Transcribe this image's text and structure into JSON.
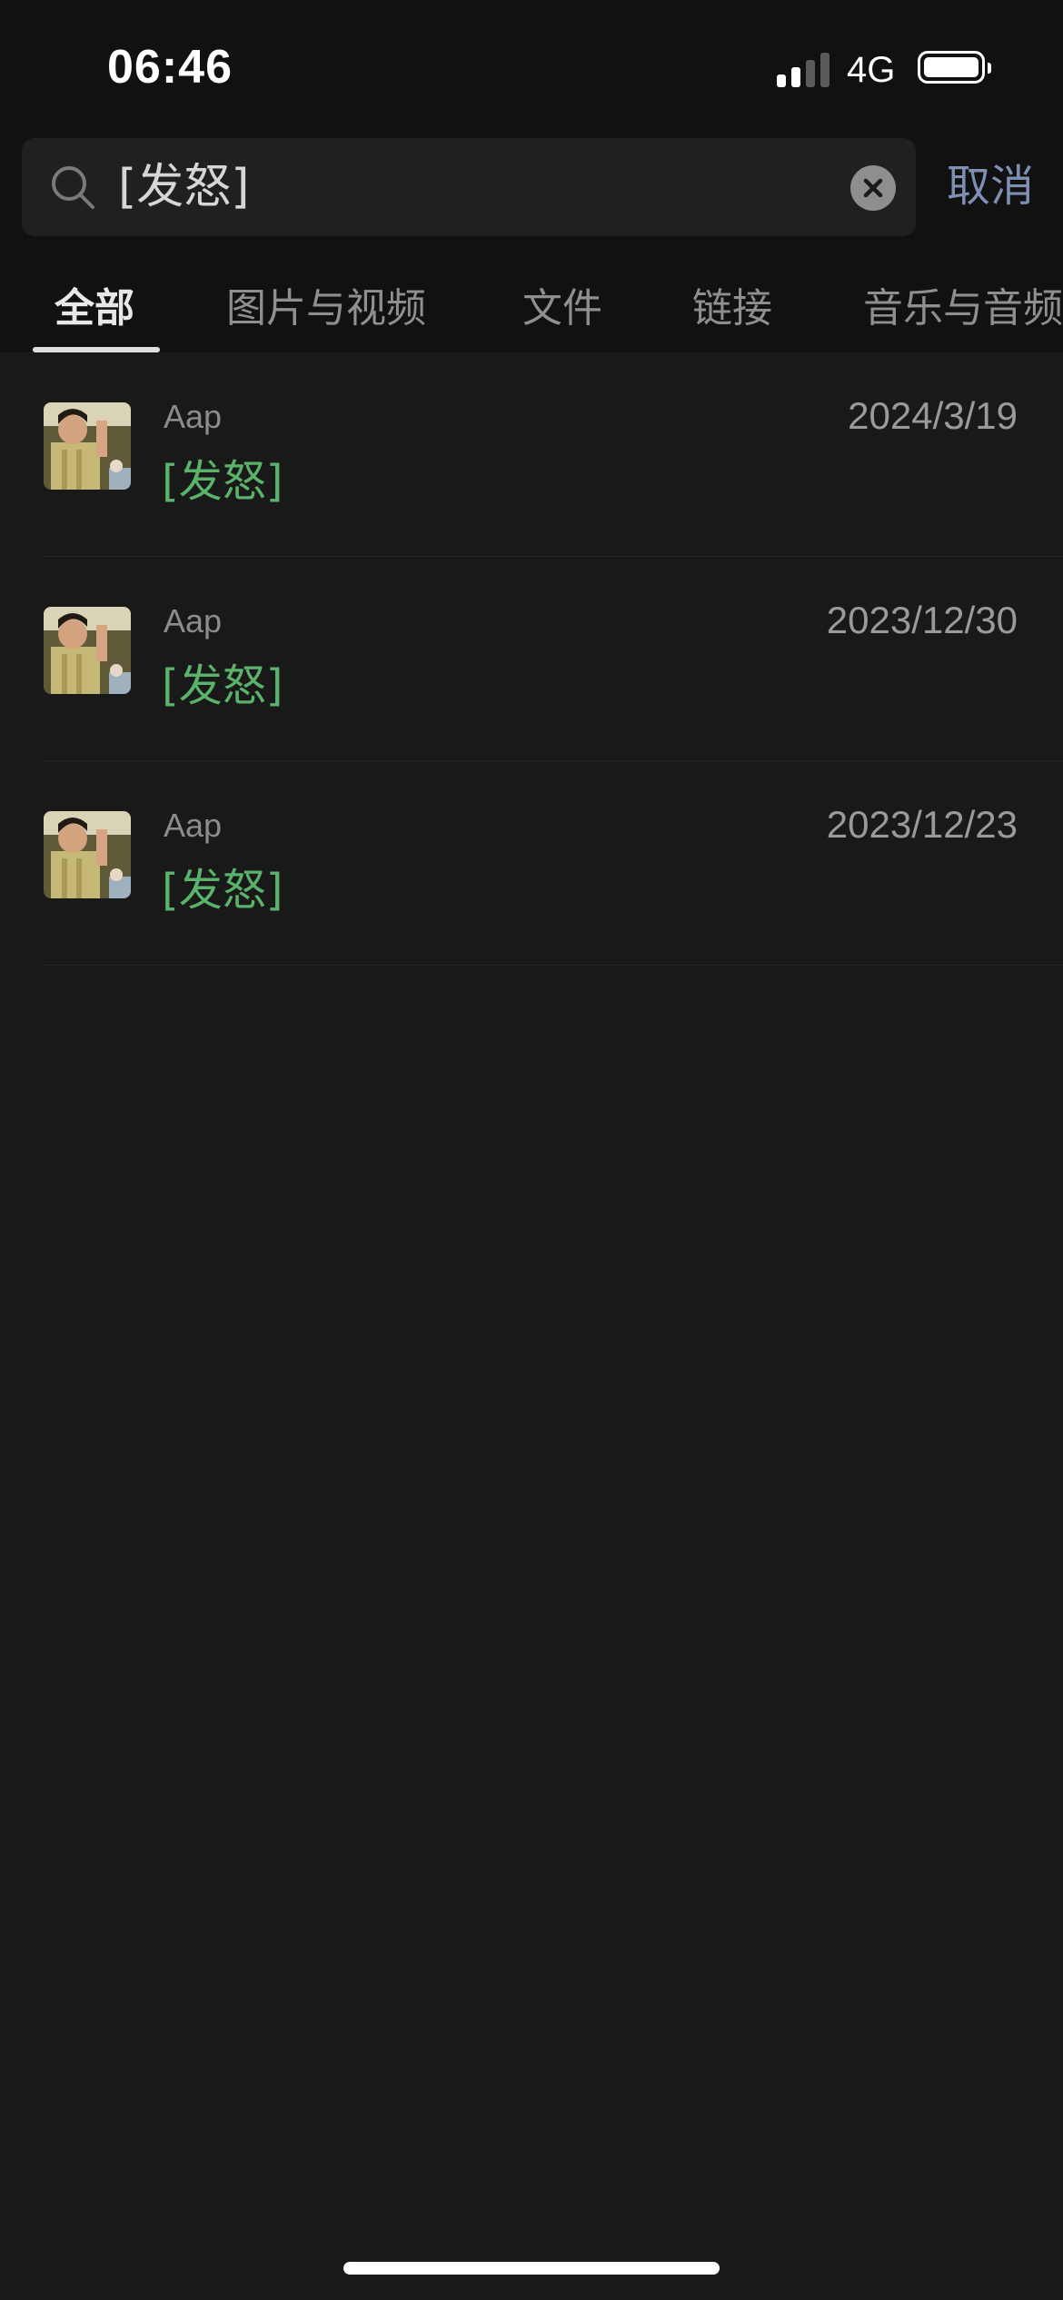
{
  "status_bar": {
    "time": "06:46",
    "network": "4G",
    "signal_bars_active": 2,
    "signal_bars_total": 4,
    "battery_level": 1.0
  },
  "search": {
    "query": "[发怒]",
    "cancel_label": "取消"
  },
  "tabs": [
    {
      "label": "全部",
      "active": true
    },
    {
      "label": "图片与视频",
      "active": false
    },
    {
      "label": "文件",
      "active": false
    },
    {
      "label": "链接",
      "active": false
    },
    {
      "label": "音乐与音频",
      "active": false
    }
  ],
  "results": [
    {
      "sender": "Aap",
      "message": "[发怒]",
      "date": "2024/3/19"
    },
    {
      "sender": "Aap",
      "message": "[发怒]",
      "date": "2023/12/30"
    },
    {
      "sender": "Aap",
      "message": "[发怒]",
      "date": "2023/12/23"
    }
  ],
  "colors": {
    "background": "#191919",
    "header_background": "#111111",
    "search_field": "#202020",
    "highlight_green": "#59b36a",
    "cancel_blue": "#7d8fb3",
    "secondary_text": "#8c8c8c"
  },
  "icons": {
    "search": "search-icon",
    "clear": "clear-icon",
    "battery": "battery-icon",
    "signal": "signal-icon"
  }
}
